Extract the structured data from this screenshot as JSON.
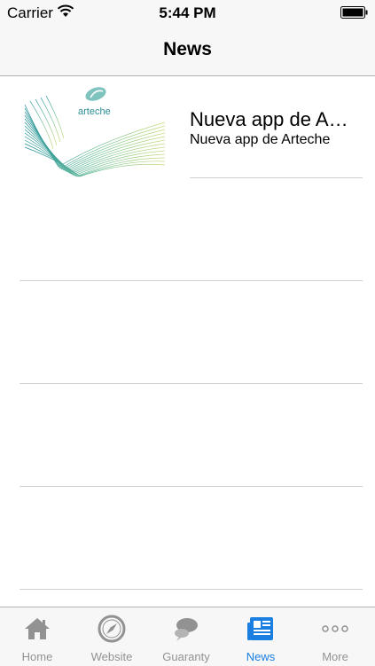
{
  "status_bar": {
    "carrier": "Carrier",
    "time": "5:44 PM"
  },
  "nav": {
    "title": "News"
  },
  "news": {
    "items": [
      {
        "title": "Nueva app de A…",
        "subtitle": "Nueva app de Arteche",
        "logo_text": "arteche"
      }
    ]
  },
  "tabbar": {
    "tabs": [
      {
        "label": "Home",
        "icon": "home-icon"
      },
      {
        "label": "Website",
        "icon": "compass-icon"
      },
      {
        "label": "Guaranty",
        "icon": "chat-bubbles-icon"
      },
      {
        "label": "News",
        "icon": "newspaper-icon",
        "active": true
      },
      {
        "label": "More",
        "icon": "more-dots-icon"
      }
    ]
  },
  "colors": {
    "active": "#1a7fe0",
    "inactive": "#929292",
    "bar": "#f7f7f7"
  }
}
